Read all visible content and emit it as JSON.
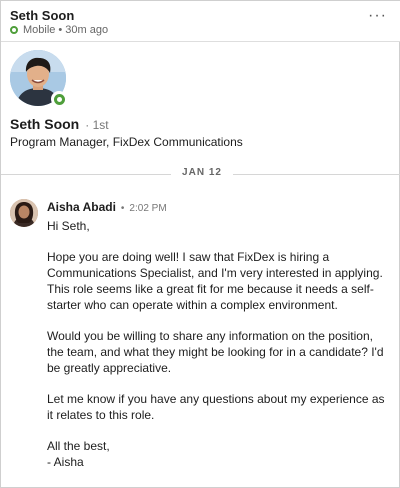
{
  "header": {
    "name": "Seth Soon",
    "status_mode": "Mobile",
    "status_time": "30m ago",
    "more_icon": "more-horizontal-icon"
  },
  "profile": {
    "name": "Seth Soon",
    "degree": "· 1st",
    "headline": "Program Manager, FixDex Communications",
    "online_color": "#4e9e3a"
  },
  "thread": {
    "date_label": "JAN 12"
  },
  "message": {
    "sender": "Aisha Abadi",
    "time": "2:02 PM",
    "greeting": "Hi Seth,",
    "paragraph_1": "Hope you are doing well! I saw that FixDex is hiring a Communications Specialist, and I'm very interested in applying. This role seems like a great fit for me because it needs a self-starter who can operate within a complex environment.",
    "paragraph_2": "Would you be willing to share any information on the position, the team, and what they might be looking for in a candidate? I'd be greatly appreciative.",
    "paragraph_3": "Let me know if you have any questions about my experience as it relates to this role.",
    "closing": "All the best,",
    "signature": "- Aisha"
  }
}
